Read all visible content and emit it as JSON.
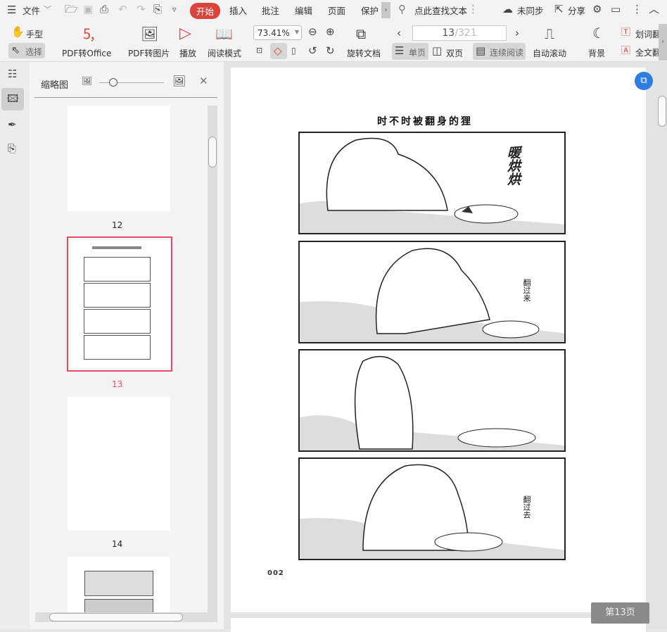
{
  "menu": {
    "file": "文件",
    "tabs": [
      "开始",
      "插入",
      "批注",
      "编辑",
      "页面",
      "保护"
    ],
    "search_placeholder": "点此查找文本",
    "sync": "未同步",
    "share": "分享"
  },
  "toolbar": {
    "hand": "手型",
    "select": "选择",
    "pdf_office": "PDF转Office",
    "pdf_image": "PDF转图片",
    "play": "播放",
    "read_mode": "阅读模式",
    "zoom": "73.41%",
    "rotate": "旋转文档",
    "page_current": "13",
    "page_total": "/321",
    "single": "单页",
    "double": "双页",
    "continuous": "连续阅读",
    "auto_scroll": "自动滚动",
    "background": "背景",
    "word_translate": "划词翻",
    "full_translate": "全文翻"
  },
  "sidebar": {
    "title": "缩略图",
    "thumbs": [
      {
        "label": "12"
      },
      {
        "label": "13"
      },
      {
        "label": "14"
      }
    ]
  },
  "document": {
    "title": "时不时被翻身的狸",
    "sfx1": "暖烘烘",
    "sfx2": "翻过来",
    "sfx4": "翻过去",
    "page_number": "002",
    "page_badge": "第13页"
  },
  "colors": {
    "accent": "#d9443d",
    "selected_thumb": "#e84a5f"
  }
}
